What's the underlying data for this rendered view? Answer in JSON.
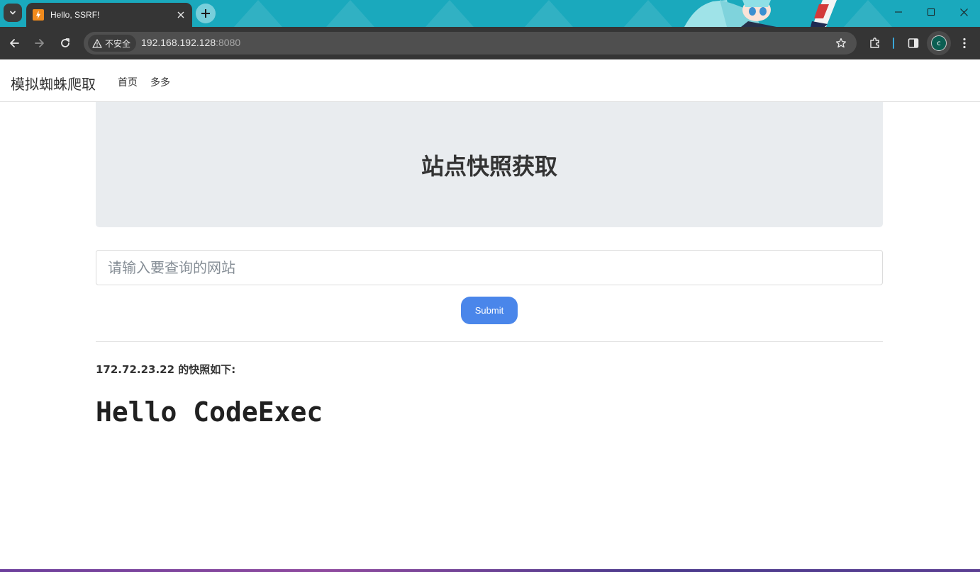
{
  "browser": {
    "tab_title": "Hello, SSRF!",
    "security_label": "不安全",
    "url_host": "192.168.192.128",
    "url_port": ":8080",
    "profile_initial": "c"
  },
  "navbar": {
    "brand": "模拟蜘蛛爬取",
    "links": [
      "首页",
      "多多"
    ]
  },
  "jumbotron": {
    "heading": "站点快照获取"
  },
  "form": {
    "input_placeholder": "请输入要查询的网站",
    "input_value": "",
    "submit_label": "Submit"
  },
  "result": {
    "label": "172.72.23.22 的快照如下:",
    "content": "Hello CodeExec"
  },
  "colors": {
    "titlebar": "#1aa9bd",
    "toolbar": "#353535",
    "jumbotron_bg": "#e9ecef",
    "submit_bg": "#4a86ea"
  }
}
